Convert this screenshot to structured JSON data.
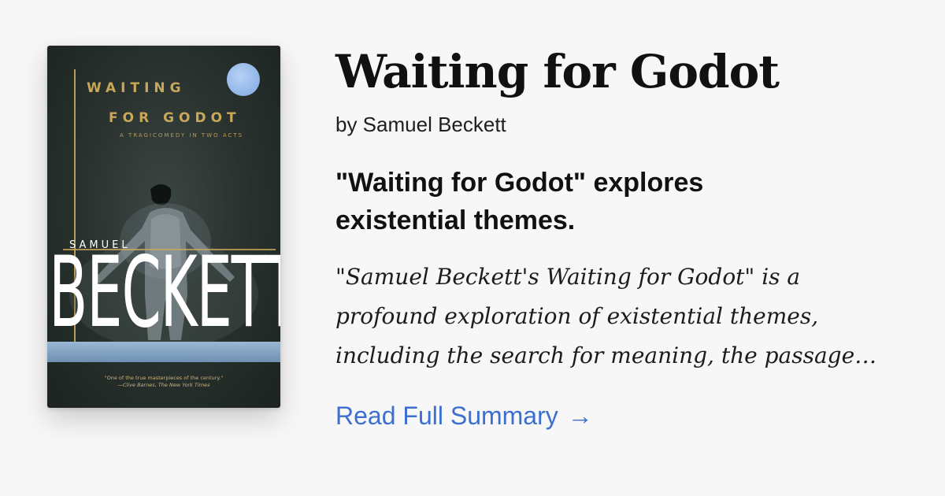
{
  "book": {
    "title": "Waiting for Godot",
    "byline": "by Samuel Beckett"
  },
  "summary": {
    "headline": "\"Waiting for Godot\" explores existential themes.",
    "excerpt_lines": [
      "\"Samuel Beckett's Waiting for Godot\" is a",
      "profound exploration of existential themes,",
      "including the search for meaning, the passage…"
    ],
    "link_label": "Read Full Summary",
    "link_icon": "→"
  },
  "cover": {
    "title_line1": "WAITING",
    "title_line2": "FOR GODOT",
    "subtitle": "A TRAGICOMEDY IN TWO ACTS",
    "author_first": "SAMUEL",
    "author_last": "BECKETT",
    "quote": "\"One of the true masterpieces of the century.\"",
    "quote_attribution": "—Clive Barnes, The New York Times"
  },
  "colors": {
    "link": "#3c6fd0",
    "cover_gold": "#c9a75a",
    "cover_background": "#27302c"
  }
}
